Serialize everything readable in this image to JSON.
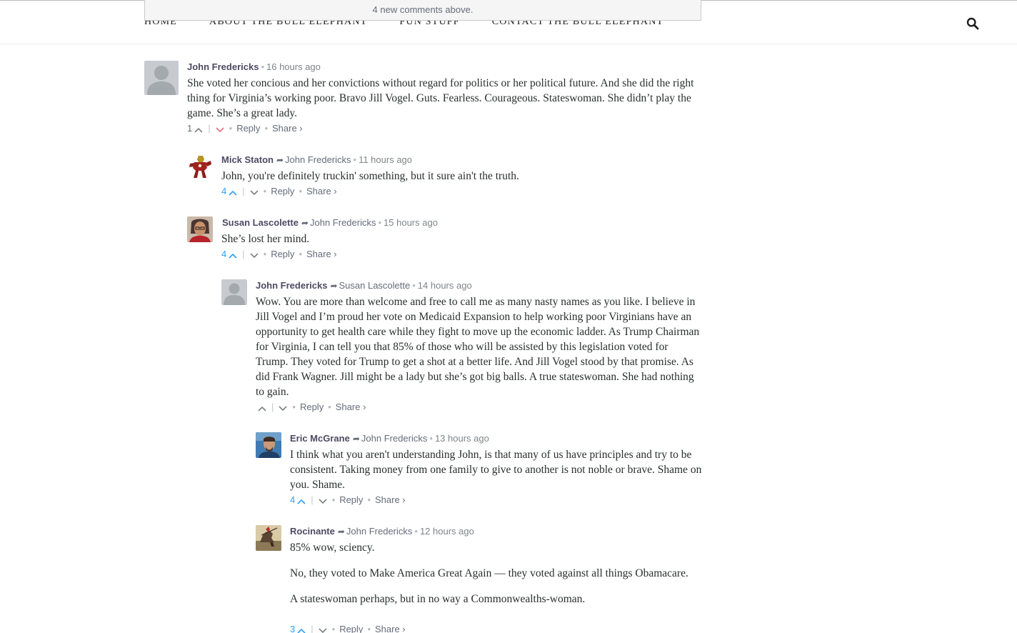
{
  "nav": {
    "items": [
      "HOME",
      "ABOUT THE BULL ELEPHANT",
      "FUN STUFF",
      "CONTACT THE BULL ELEPHANT"
    ]
  },
  "banner": {
    "new_comments": "4 new comments above."
  },
  "labels": {
    "reply": "Reply",
    "share": "Share ›"
  },
  "colors": {
    "author": "#4d4a63",
    "upvote_active": "#2e9fff",
    "downvote_active": "#e8697d",
    "text": "#2a2e2e"
  },
  "comments": [
    {
      "author": "John Fredericks",
      "reply_to": "",
      "time": "16 hours ago",
      "avatar": "default-avatar",
      "paragraphs": [
        "She voted her concious and her convictions without regard for politics or her political future. And she did the right thing for Virginia’s working poor. Bravo Jill Vogel. Guts. Fearless. Courageous. Stateswoman. She didn’t play the game. She’s a great lady."
      ],
      "upvotes": "1"
    },
    {
      "author": "Mick Staton",
      "reply_to": "John Fredericks",
      "time": "11 hours ago",
      "avatar": "ironman-avatar",
      "paragraphs": [
        "John, you're definitely truckin' something, but it sure ain't the truth."
      ],
      "upvotes": "4"
    },
    {
      "author": "Susan Lascolette",
      "reply_to": "John Fredericks",
      "time": "15 hours ago",
      "avatar": "photo-avatar",
      "paragraphs": [
        "She’s lost her mind."
      ],
      "upvotes": "4"
    },
    {
      "author": "John Fredericks",
      "reply_to": "Susan Lascolette",
      "time": "14 hours ago",
      "avatar": "default-avatar",
      "paragraphs": [
        "Wow. You are more than welcome and free to call me as many nasty names as you like. I believe in Jill Vogel and I’m proud her vote on Medicaid Expansion to help working poor Virginians have an opportunity to get health care while they fight to move up the economic ladder. As Trump Chairman for Virginia, I can tell you that 85% of those who will be assisted by this legislation voted for Trump. They voted for Trump to get a shot at a better life. And Jill Vogel stood by that promise. As did Frank Wagner. Jill might be a lady but she’s got big balls. A true stateswoman. She had nothing to gain."
      ],
      "upvotes": ""
    },
    {
      "author": "Eric McGrane",
      "reply_to": "John Fredericks",
      "time": "13 hours ago",
      "avatar": "photo-avatar",
      "paragraphs": [
        "I think what you aren't understanding John, is that many of us have principles and try to be consistent. Taking money from one family to give to another is not noble or brave. Shame on you. Shame."
      ],
      "upvotes": "4"
    },
    {
      "author": "Rocinante",
      "reply_to": "John Fredericks",
      "time": "12 hours ago",
      "avatar": "painting-avatar",
      "paragraphs": [
        "85% wow, sciency.",
        "No, they voted to Make America Great Again — they voted against all things Obamacare.",
        "A stateswoman perhaps, but in no way a Commonwealths-woman."
      ],
      "upvotes": "3"
    }
  ]
}
